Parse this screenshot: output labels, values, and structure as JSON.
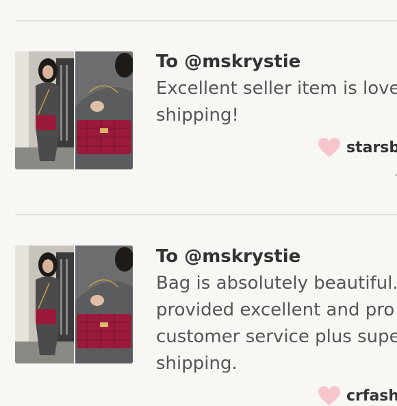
{
  "reviews": [
    {
      "recipient": "To @mskrystie",
      "comment_lines": [
        "Excellent seller item is love",
        "shipping!"
      ],
      "author": "starsbl"
    },
    {
      "recipient": "To @mskrystie",
      "comment_lines": [
        "Bag is absolutely beautiful.",
        "provided excellent and pro",
        "customer service plus supe",
        "shipping."
      ],
      "author": "crfashi"
    }
  ],
  "colors": {
    "background": "#f8f7f4",
    "divider": "#e3e1dc",
    "heart": "#f7c6cc",
    "bag": "#9b1a3c"
  },
  "icons": [
    "heart-icon"
  ]
}
